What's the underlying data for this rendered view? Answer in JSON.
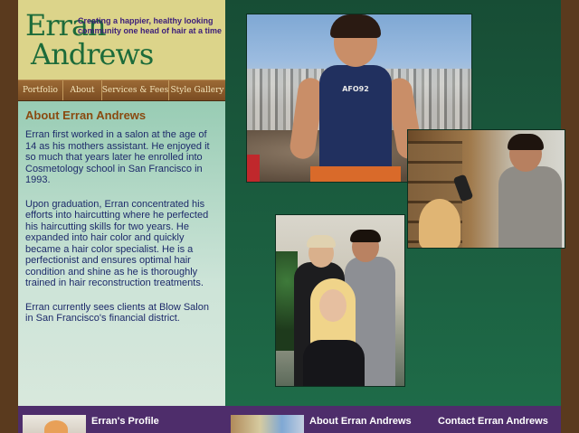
{
  "logo": {
    "line1": "Erran",
    "line2": "Andrews"
  },
  "tagline": "Creating a happier, healthy looking community one head of hair at a time",
  "nav": [
    {
      "label": "Portfolio"
    },
    {
      "label": "About"
    },
    {
      "label": "Services & Fees"
    },
    {
      "label": "Style Gallery"
    }
  ],
  "content": {
    "title": "About Erran Andrews",
    "paragraphs": [
      "Erran first worked in a salon at the age of 14 as his mothers assistant. He enjoyed it so much that years later he enrolled into Cosmetology school in San Francisco in 1993.",
      "Upon graduation, Erran concentrated his efforts into haircutting where he perfected his haircutting skills for two years. He expanded into hair color and quickly became a hair color specialist. He is a perfectionist and ensures optimal hair condition and shine as he is thoroughly trained in hair reconstruction treatments.",
      "Erran currently sees clients at Blow Salon in San Francisco's financial district."
    ]
  },
  "photos": {
    "man_shirt_text": "AFO92"
  },
  "footer": {
    "profile_label": "Erran's Profile",
    "about_label": "About Erran Andrews",
    "contact_label": "Contact Erran Andrews"
  },
  "colors": {
    "background": "#5a3a1e",
    "header": "#dcd48a",
    "logo": "#1c6b3a",
    "tagline": "#3b1d7a",
    "nav": "#8a5a2c",
    "content_title": "#8a4a10",
    "content_text": "#1d2a6a",
    "right_panel": "#1e6b48",
    "footer": "#4e2d6b"
  }
}
